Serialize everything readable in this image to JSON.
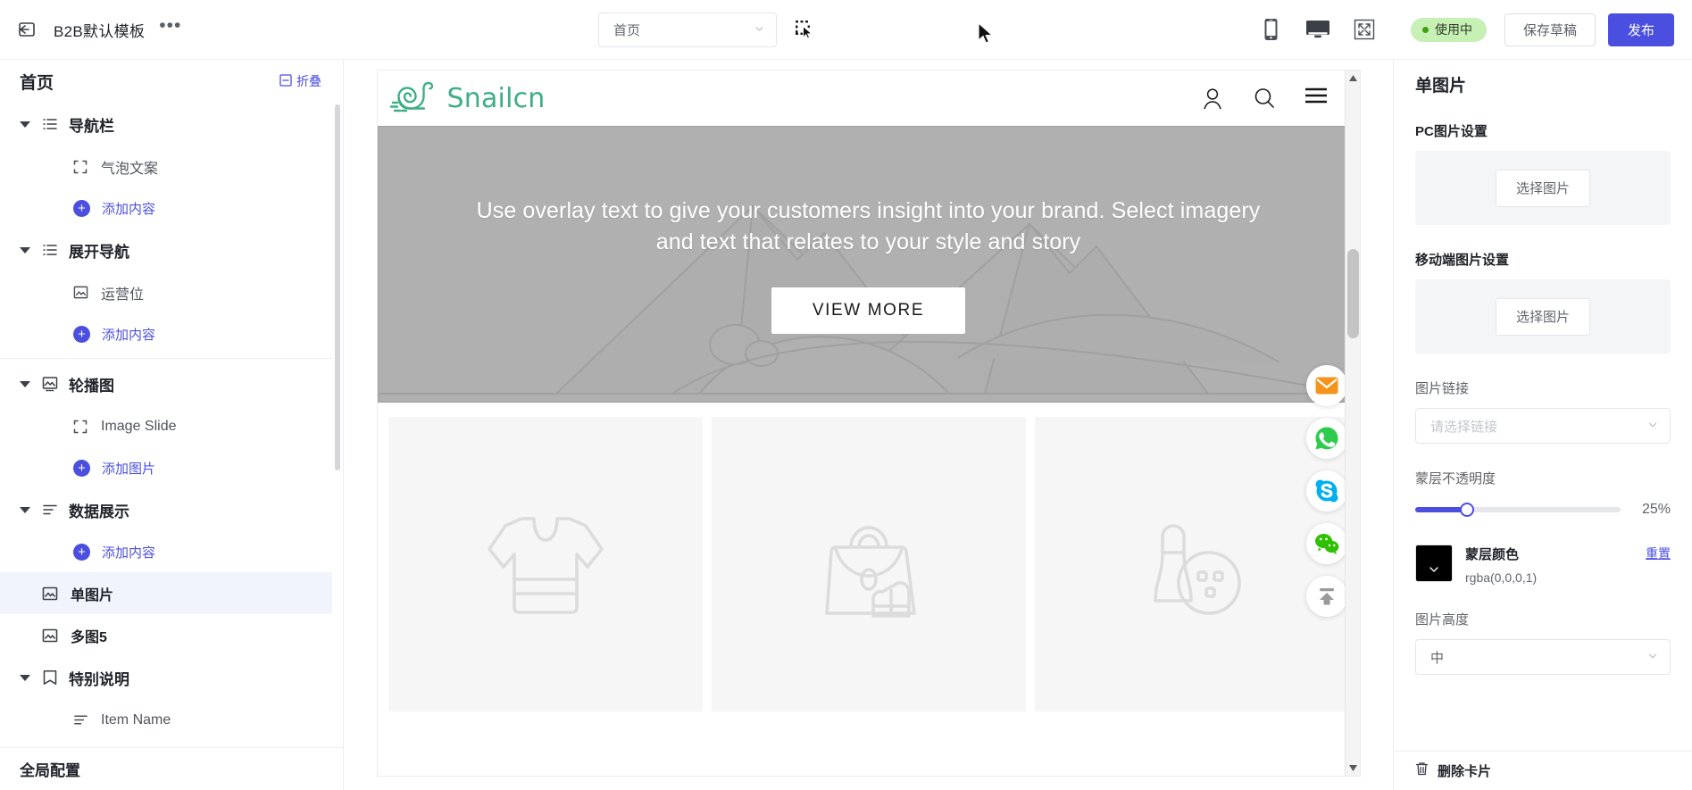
{
  "topbar": {
    "back_icon": "back-arrow-icon",
    "template_name": "B2B默认模板",
    "more_icon": "ellipsis-icon",
    "page_select_value": "首页",
    "select_tool_icon": "region-select-icon",
    "device_mobile_icon": "mobile-icon",
    "device_desktop_icon": "desktop-icon",
    "fullscreen_icon": "fullscreen-icon",
    "status_badge": "使用中",
    "save_draft": "保存草稿",
    "publish": "发布",
    "accent_color": "#4b4fe0",
    "badge_bg": "#c6f0b4",
    "badge_dot": "#3ea014"
  },
  "sidebar": {
    "title": "首页",
    "collapse_label": "折叠",
    "collapse_icon": "collapse-icon",
    "footer_label": "全局配置",
    "groups": [
      {
        "label": "导航栏",
        "icon": "list-icon",
        "children": [
          {
            "label": "气泡文案",
            "icon": "frame-icon",
            "type": "item",
            "selected": false
          },
          {
            "label": "添加内容",
            "icon": "plus-icon",
            "type": "add"
          }
        ]
      },
      {
        "label": "展开导航",
        "icon": "list-icon",
        "children": [
          {
            "label": "运营位",
            "icon": "image-icon",
            "type": "item",
            "selected": false
          },
          {
            "label": "添加内容",
            "icon": "plus-icon",
            "type": "add"
          }
        ]
      },
      {
        "label": "轮播图",
        "icon": "picture-icon",
        "children": [
          {
            "label": "Image Slide",
            "icon": "frame-icon",
            "type": "item",
            "selected": false
          },
          {
            "label": "添加图片",
            "icon": "plus-icon",
            "type": "add"
          }
        ]
      },
      {
        "label": "数据展示",
        "icon": "align-icon",
        "children": [
          {
            "label": "添加内容",
            "icon": "plus-icon",
            "type": "add"
          }
        ]
      }
    ],
    "flat_items": [
      {
        "label": "单图片",
        "icon": "image-icon",
        "selected": true
      },
      {
        "label": "多图5",
        "icon": "image-icon",
        "selected": false
      }
    ],
    "last_group": {
      "label": "特别说明",
      "icon": "note-icon",
      "children": [
        {
          "label": "Item Name",
          "icon": "align-icon",
          "type": "item",
          "selected": false
        }
      ]
    }
  },
  "canvas": {
    "site_logo_text": "Snailcn",
    "site_logo_icon": "snail-logo-icon",
    "logo_color": "#3fae85",
    "header_icons": [
      {
        "name": "user-account-icon"
      },
      {
        "name": "search-icon"
      },
      {
        "name": "hamburger-menu-icon"
      }
    ],
    "hero": {
      "text": "Use overlay text to give your customers insight into your brand. Select imagery and text that relates to your style and story",
      "button": "VIEW MORE"
    },
    "cards": [
      {
        "icon": "tshirt-placeholder-icon"
      },
      {
        "icon": "handbag-placeholder-icon"
      },
      {
        "icon": "bowling-placeholder-icon"
      }
    ],
    "social_rail": [
      {
        "name": "email-icon",
        "color": "#f5941d"
      },
      {
        "name": "whatsapp-icon",
        "color": "#2dcc4d"
      },
      {
        "name": "skype-icon",
        "color": "#00aff0"
      },
      {
        "name": "wechat-icon",
        "color": "#2dc100"
      },
      {
        "name": "back-to-top-icon",
        "color": "#9a9a9a"
      }
    ],
    "scroll_up_icon": "scroll-up-arrow-icon",
    "scroll_down_icon": "scroll-down-arrow-icon"
  },
  "right_panel": {
    "title": "单图片",
    "pc_image_label": "PC图片设置",
    "pc_image_button": "选择图片",
    "mobile_image_label": "移动端图片设置",
    "mobile_image_button": "选择图片",
    "link_label": "图片链接",
    "link_placeholder": "请选择链接",
    "opacity_label": "蒙层不透明度",
    "opacity_value": "25%",
    "opacity_percent": 25,
    "mask_color_label": "蒙层颜色",
    "mask_color_value": "rgba(0,0,0,1)",
    "mask_color_hex": "#000000",
    "reset_label": "重置",
    "height_label": "图片高度",
    "height_value": "中",
    "delete_label": "删除卡片",
    "delete_icon": "trash-icon"
  }
}
